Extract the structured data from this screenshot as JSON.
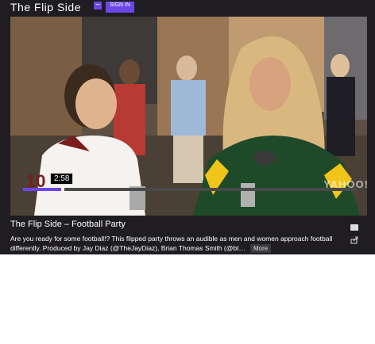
{
  "header": {
    "title": "The Flip Side",
    "minus_label": "−",
    "signin_label": "SIGN IN"
  },
  "player": {
    "current_time": "2:58",
    "progress": 0.12,
    "watermark": "YAHOO!",
    "scene": "screen-shot-video-frame"
  },
  "video": {
    "title": "The Flip Side – Football Party",
    "description": "Are you ready for some football!? This flipped party throws an audible as men and women approach football differently. Produced by Jay Diaz (@TheJayDiaz), Brian Thomas Smith (@bt…",
    "more_label": "More"
  },
  "icons": {
    "comment": "comment-icon",
    "share": "share-icon"
  },
  "colors": {
    "accent": "#6b46e6",
    "background": "#1f1d22"
  }
}
